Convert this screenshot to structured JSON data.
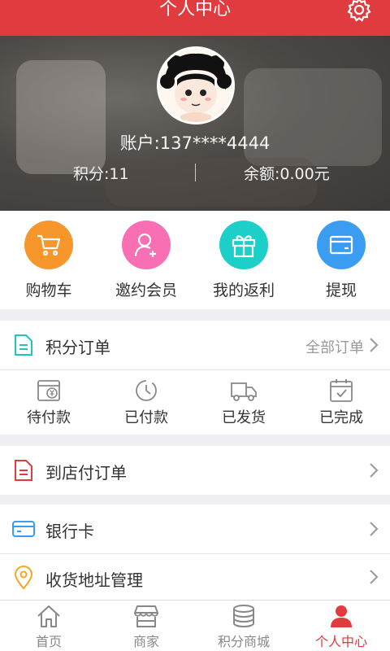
{
  "header": {
    "title": "个人中心",
    "settings_icon": "gear-icon"
  },
  "profile": {
    "account": "账户:137****4444",
    "points": "积分:11",
    "balance": "余额:0.00元"
  },
  "quick_actions": [
    {
      "label": "购物车",
      "icon": "cart-icon",
      "color": "#f7962b"
    },
    {
      "label": "邀约会员",
      "icon": "add-user-icon",
      "color": "#f86fb4"
    },
    {
      "label": "我的返利",
      "icon": "gift-icon",
      "color": "#1cd0c9"
    },
    {
      "label": "提现",
      "icon": "card-icon",
      "color": "#3b9df1"
    }
  ],
  "points_order": {
    "label": "积分订单",
    "more": "全部订单"
  },
  "order_status": [
    {
      "label": "待付款",
      "icon": "wallet-yen-icon"
    },
    {
      "label": "已付款",
      "icon": "clock-icon"
    },
    {
      "label": "已发货",
      "icon": "truck-icon"
    },
    {
      "label": "已完成",
      "icon": "calendar-check-icon"
    }
  ],
  "store_order": {
    "label": "到店付订单"
  },
  "bank_card": {
    "label": "银行卡"
  },
  "address": {
    "label": "收货地址管理"
  },
  "tabbar": [
    {
      "label": "首页",
      "icon": "home-icon"
    },
    {
      "label": "商家",
      "icon": "store-icon"
    },
    {
      "label": "积分商城",
      "icon": "coins-icon"
    },
    {
      "label": "个人中心",
      "icon": "user-icon",
      "active": true
    }
  ],
  "colors": {
    "accent": "#e03c3f",
    "teal": "#1cc7c2",
    "blue": "#3b9df1",
    "orange": "#f5a623"
  }
}
